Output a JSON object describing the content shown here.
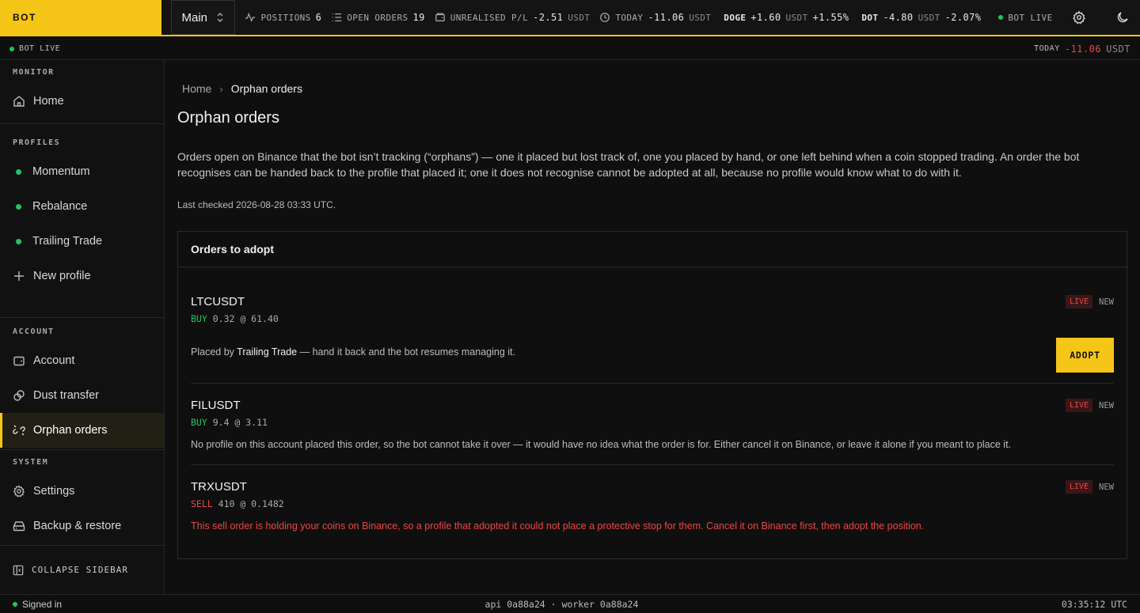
{
  "app": {
    "brand": "BOT"
  },
  "topbar": {
    "profile": "Main",
    "positions": {
      "label": "POSITIONS",
      "value": "6"
    },
    "open_orders": {
      "label": "OPEN ORDERS",
      "value": "19"
    },
    "unrealised": {
      "label": "UNREALISED P/L",
      "value": "-2.51",
      "unit": "USDT"
    },
    "today": {
      "label": "TODAY",
      "value": "-11.06",
      "unit": "USDT"
    },
    "tickers": [
      {
        "symbol": "DOGE",
        "change": "+1.60",
        "unit": "USDT",
        "pct": "+1.55%"
      },
      {
        "symbol": "DOT",
        "change": "-4.80",
        "unit": "USDT",
        "pct": "-2.07%"
      }
    ],
    "bot_live": "BOT LIVE"
  },
  "strip": {
    "bot_live": "BOT LIVE",
    "today_label": "TODAY",
    "today_value": "-11.06",
    "today_unit": "USDT"
  },
  "sidebar": {
    "monitor_title": "MONITOR",
    "home": "Home",
    "profiles_title": "PROFILES",
    "profiles": [
      "Momentum",
      "Rebalance",
      "Trailing Trade"
    ],
    "new_profile": "New profile",
    "account_title": "ACCOUNT",
    "account": "Account",
    "dust": "Dust transfer",
    "orphan": "Orphan orders",
    "system_title": "SYSTEM",
    "settings": "Settings",
    "backup": "Backup & restore",
    "collapse": "COLLAPSE SIDEBAR"
  },
  "main": {
    "breadcrumb_home": "Home",
    "breadcrumb_current": "Orphan orders",
    "title": "Orphan orders",
    "description": "Orders open on Binance that the bot isn’t tracking (“orphans”) — one it placed but lost track of, one you placed by hand, or one left behind when a coin stopped trading. An order the bot recognises can be handed back to the profile that placed it; one it does not recognise cannot be adopted at all, because no profile would know what to do with it.",
    "last_checked": "Last checked 2026-08-28 03:33 UTC.",
    "panel_title": "Orders to adopt",
    "orders": [
      {
        "symbol": "LTCUSDT",
        "side": "BUY",
        "qty": "0.32 @ 61.40",
        "live": "LIVE",
        "status": "NEW",
        "note_prefix": "Placed by ",
        "note_profile": "Trailing Trade",
        "note_suffix": " — hand it back and the bot resumes managing it.",
        "action": "ADOPT"
      },
      {
        "symbol": "FILUSDT",
        "side": "BUY",
        "qty": "9.4 @ 3.11",
        "live": "LIVE",
        "status": "NEW",
        "note": "No profile on this account placed this order, so the bot cannot take it over — it would have no idea what the order is for. Either cancel it on Binance, or leave it alone if you meant to place it."
      },
      {
        "symbol": "TRXUSDT",
        "side": "SELL",
        "qty": "410 @ 0.1482",
        "live": "LIVE",
        "status": "NEW",
        "note": "This sell order is holding your coins on Binance, so a profile that adopted it could not place a protective stop for them. Cancel it on Binance first, then adopt the position."
      }
    ]
  },
  "footer": {
    "signed_in": "Signed in",
    "build": "api 0a88a24 · worker 0a88a24",
    "clock": "03:35:12 UTC"
  }
}
